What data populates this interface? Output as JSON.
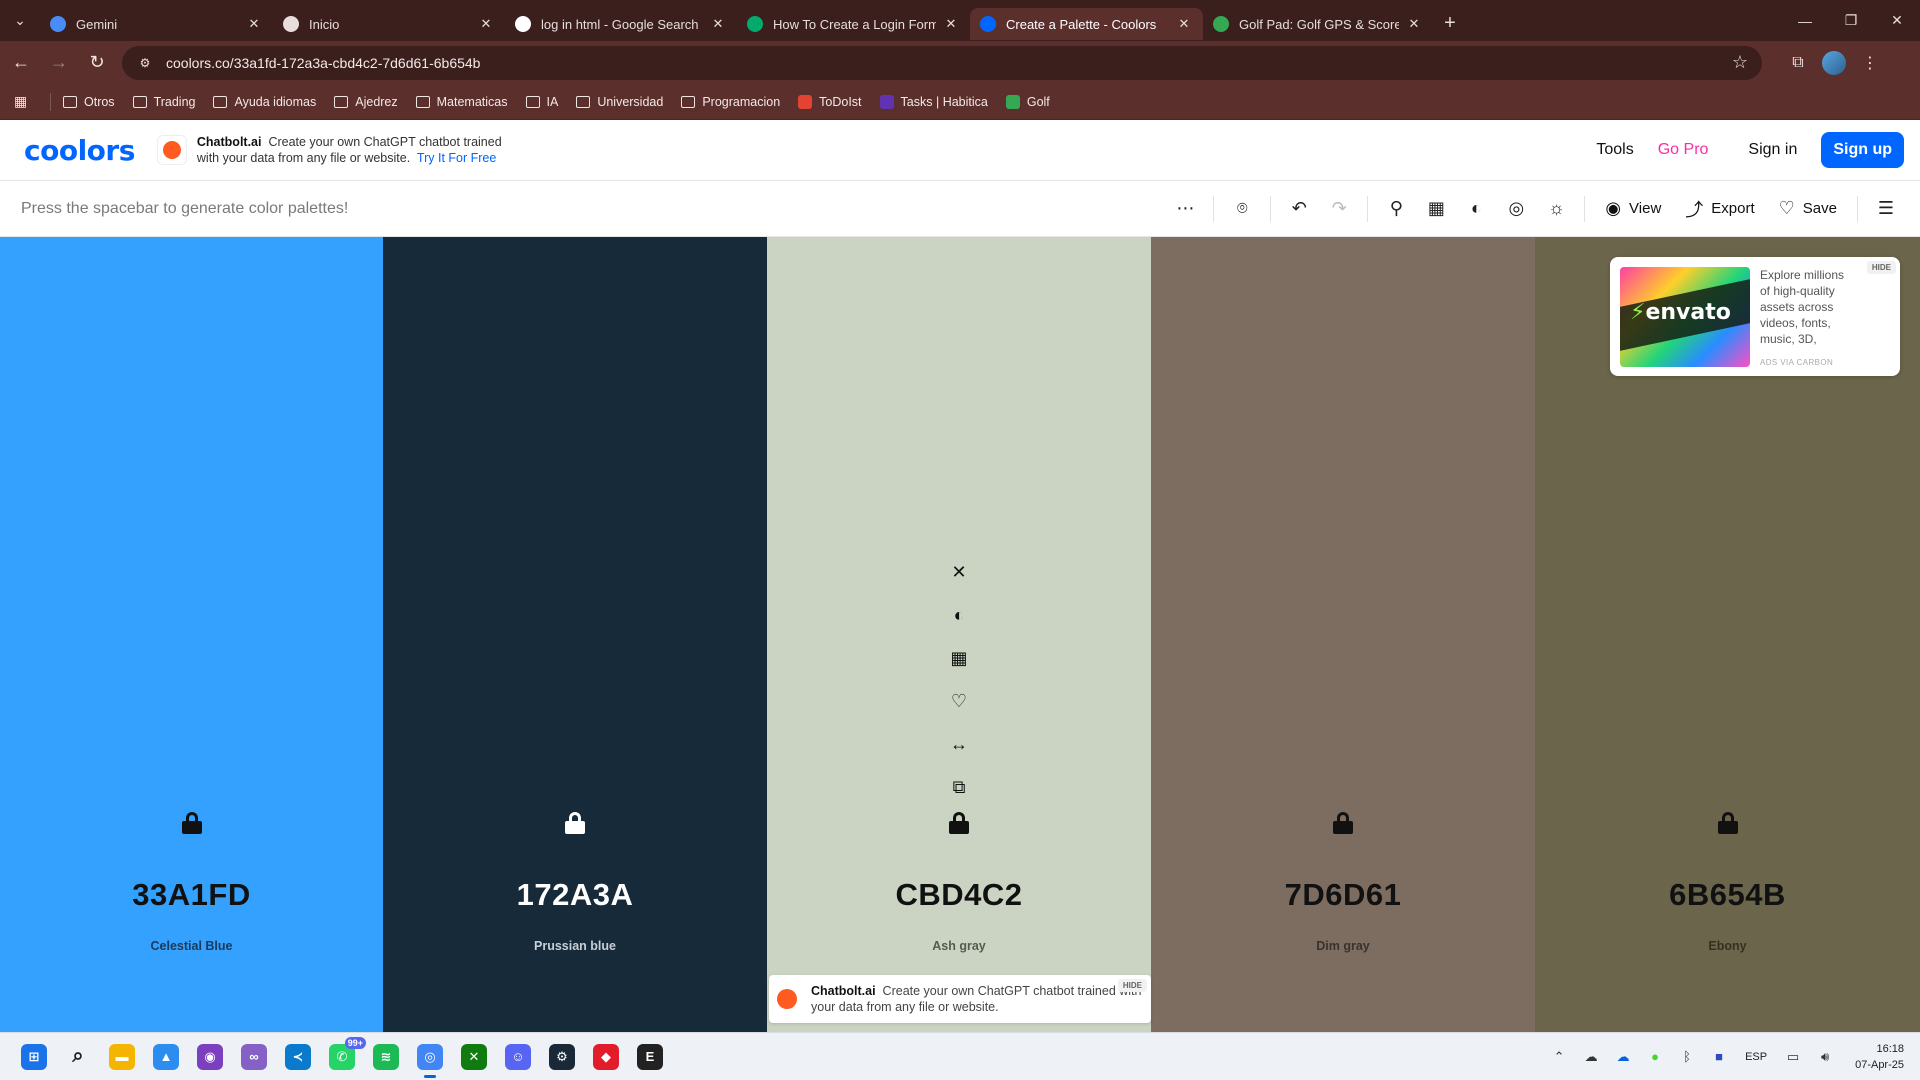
{
  "browser": {
    "tabs": [
      {
        "title": "Gemini",
        "icon": "gemini-icon",
        "color": "#4a8cf7",
        "active": false
      },
      {
        "title": "Inicio",
        "icon": "pin-icon",
        "color": "#e8dcdc",
        "active": false
      },
      {
        "title": "log in html - Google Search",
        "icon": "google-icon",
        "color": "#ffffff",
        "active": false
      },
      {
        "title": "How To Create a Login Form",
        "icon": "w3schools-icon",
        "color": "#04aa6d",
        "active": false
      },
      {
        "title": "Create a Palette - Coolors",
        "icon": "coolors-icon",
        "color": "#0066ff",
        "active": true
      },
      {
        "title": "Golf Pad: Golf GPS & Scorecard",
        "icon": "play-store-icon",
        "color": "#34a853",
        "active": false
      }
    ],
    "url": "coolors.co/33a1fd-172a3a-cbd4c2-7d6d61-6b654b",
    "bookmarks": [
      {
        "label": "Otros",
        "type": "folder"
      },
      {
        "label": "Trading",
        "type": "folder"
      },
      {
        "label": "Ayuda idiomas",
        "type": "folder"
      },
      {
        "label": "Ajedrez",
        "type": "folder"
      },
      {
        "label": "Matematicas",
        "type": "folder"
      },
      {
        "label": "IA",
        "type": "folder"
      },
      {
        "label": "Universidad",
        "type": "folder"
      },
      {
        "label": "Programacion",
        "type": "folder"
      },
      {
        "label": "ToDoIst",
        "type": "link",
        "color": "#e44332"
      },
      {
        "label": "Tasks | Habitica",
        "type": "link",
        "color": "#6133b4"
      },
      {
        "label": "Golf",
        "type": "link",
        "color": "#34a853"
      }
    ]
  },
  "header": {
    "logo": "coolors",
    "ad": {
      "brand": "Chatbolt.ai",
      "text": "Create your own ChatGPT chatbot trained with your data from any file or website.",
      "cta": "Try It For Free"
    },
    "tools": "Tools",
    "go_pro": "Go Pro",
    "sign_in": "Sign in",
    "sign_up": "Sign up"
  },
  "subbar": {
    "hint": "Press the spacebar to generate color palettes!",
    "view": "View",
    "export": "Export",
    "save": "Save"
  },
  "palette": [
    {
      "hex": "33A1FD",
      "name": "Celestial Blue",
      "bg": "#33a1fd",
      "fg": "#111111",
      "sub": "#1a3a5c"
    },
    {
      "hex": "172A3A",
      "name": "Prussian blue",
      "bg": "#172a3a",
      "fg": "#ffffff",
      "sub": "#c8cfd6"
    },
    {
      "hex": "CBD4C2",
      "name": "Ash gray",
      "bg": "#cbd4c2",
      "fg": "#111111",
      "sub": "#555b50"
    },
    {
      "hex": "7D6D61",
      "name": "Dim gray",
      "bg": "#7d6d61",
      "fg": "#111111",
      "sub": "#3a322c"
    },
    {
      "hex": "6B654B",
      "name": "Ebony",
      "bg": "#6b654b",
      "fg": "#111111",
      "sub": "#34311f"
    }
  ],
  "ad_card": {
    "brand": "envato",
    "text": "Explore millions of high-quality assets across videos, fonts, music, 3D,",
    "via": "ADS VIA CARBON",
    "hide": "HIDE"
  },
  "ad_bottom": {
    "brand": "Chatbolt.ai",
    "text": "Create your own ChatGPT chatbot trained with your data from any file or website.",
    "hide": "HIDE"
  },
  "taskbar": {
    "apps": [
      {
        "name": "start-icon",
        "color": "#1a73e8"
      },
      {
        "name": "search-icon",
        "color": "#333333"
      },
      {
        "name": "file-explorer-icon",
        "color": "#f4b400"
      },
      {
        "name": "photos-icon",
        "color": "#2d8cf0"
      },
      {
        "name": "github-desktop-icon",
        "color": "#7b3fbf"
      },
      {
        "name": "visual-studio-icon",
        "color": "#8661c5"
      },
      {
        "name": "vscode-icon",
        "color": "#0a7acc"
      },
      {
        "name": "whatsapp-icon",
        "color": "#25d366",
        "badge": "99+"
      },
      {
        "name": "spotify-icon",
        "color": "#1db954"
      },
      {
        "name": "chrome-icon",
        "color": "#4285f4",
        "active": true
      },
      {
        "name": "xbox-icon",
        "color": "#107c10"
      },
      {
        "name": "discord-icon",
        "color": "#5865f2"
      },
      {
        "name": "steam-icon",
        "color": "#1b2838"
      },
      {
        "name": "app-icon",
        "color": "#e11d2b"
      },
      {
        "name": "epic-games-icon",
        "color": "#222222"
      }
    ],
    "lang": "ESP",
    "time": "16:18",
    "date": "07-Apr-25"
  }
}
